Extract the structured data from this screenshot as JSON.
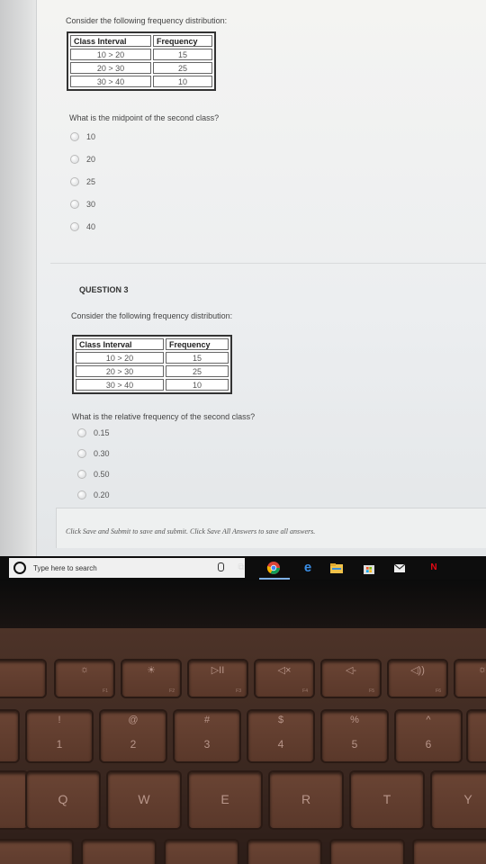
{
  "question2": {
    "prompt": "Consider the following frequency distribution:",
    "table": {
      "headers": [
        "Class Interval",
        "Frequency"
      ],
      "rows": [
        [
          "10 > 20",
          "15"
        ],
        [
          "20 > 30",
          "25"
        ],
        [
          "30 > 40",
          "10"
        ]
      ]
    },
    "question": "What is the midpoint of the second class?",
    "options": [
      "10",
      "20",
      "25",
      "30",
      "40"
    ]
  },
  "question3": {
    "heading": "QUESTION 3",
    "prompt": "Consider the following frequency distribution:",
    "table": {
      "headers": [
        "Class Interval",
        "Frequency"
      ],
      "rows": [
        [
          "10 > 20",
          "15"
        ],
        [
          "20 > 30",
          "25"
        ],
        [
          "30 > 40",
          "10"
        ]
      ]
    },
    "question": "What is the relative frequency of the second class?",
    "options": [
      "0.15",
      "0.30",
      "0.50",
      "0.20"
    ]
  },
  "footer": {
    "text": "Click Save and Submit to save and submit. Click Save All Answers to save all answers."
  },
  "taskbar": {
    "search_placeholder": "Type here to search",
    "icons": [
      "cortana-circle-icon",
      "microphone-icon",
      "task-view-icon",
      "chrome-icon",
      "edge-icon",
      "file-explorer-icon",
      "store-icon",
      "mail-icon",
      "netflix-icon"
    ]
  },
  "keyboard": {
    "fn_row": [
      {
        "top": "☼",
        "sub": "F1"
      },
      {
        "top": "☀",
        "sub": "F2"
      },
      {
        "top": "▷II",
        "sub": "F3"
      },
      {
        "top": "◁×",
        "sub": "F4"
      },
      {
        "top": "◁-",
        "sub": "F5"
      },
      {
        "top": "◁))",
        "sub": "F6"
      }
    ],
    "number_row": [
      {
        "top": "!",
        "main": "1"
      },
      {
        "top": "@",
        "main": "2"
      },
      {
        "top": "#",
        "main": "3"
      },
      {
        "top": "$",
        "main": "4"
      },
      {
        "top": "%",
        "main": "5"
      },
      {
        "top": "^",
        "main": "6"
      }
    ],
    "letter_row": [
      "Q",
      "W",
      "E",
      "R",
      "T",
      "Y"
    ]
  }
}
